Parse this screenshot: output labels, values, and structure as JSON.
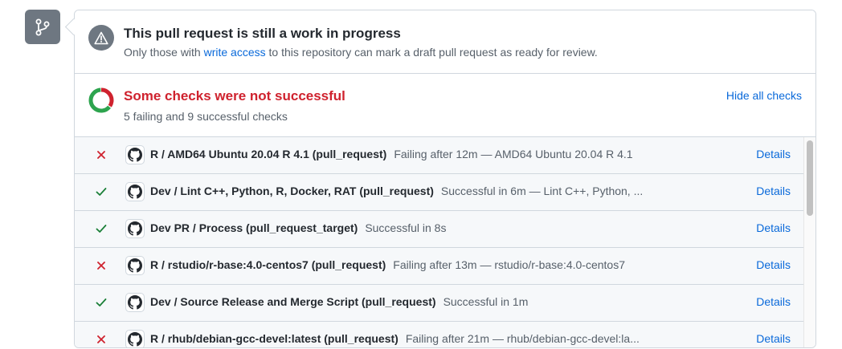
{
  "draft": {
    "title": "This pull request is still a work in progress",
    "desc_before": "Only those with ",
    "desc_link": "write access",
    "desc_after": " to this repository can mark a draft pull request as ready for review."
  },
  "checks_summary": {
    "title": "Some checks were not successful",
    "subtitle": "5 failing and 9 successful checks",
    "hide_link": "Hide all checks",
    "failing": 5,
    "successful": 9,
    "colors": {
      "failing": "#cf222e",
      "success": "#2da44e"
    }
  },
  "checks": [
    {
      "status": "failure",
      "name": "R / AMD64 Ubuntu 20.04 R 4.1 (pull_request)",
      "description": "Failing after 12m — AMD64 Ubuntu 20.04 R 4.1",
      "details": "Details"
    },
    {
      "status": "success",
      "name": "Dev / Lint C++, Python, R, Docker, RAT (pull_request)",
      "description": "Successful in 6m — Lint C++, Python, ...",
      "details": "Details"
    },
    {
      "status": "success",
      "name": "Dev PR / Process (pull_request_target)",
      "description": "Successful in 8s",
      "details": "Details"
    },
    {
      "status": "failure",
      "name": "R / rstudio/r-base:4.0-centos7 (pull_request)",
      "description": "Failing after 13m — rstudio/r-base:4.0-centos7",
      "details": "Details"
    },
    {
      "status": "success",
      "name": "Dev / Source Release and Merge Script (pull_request)",
      "description": "Successful in 1m",
      "details": "Details"
    },
    {
      "status": "failure",
      "name": "R / rhub/debian-gcc-devel:latest (pull_request)",
      "description": "Failing after 21m — rhub/debian-gcc-devel:la...",
      "details": "Details"
    }
  ],
  "icons": {
    "merge_badge": "git-branch-icon",
    "draft_alert": "alert-icon",
    "failure": "x-icon",
    "success": "check-icon",
    "check_app": "github-icon"
  }
}
